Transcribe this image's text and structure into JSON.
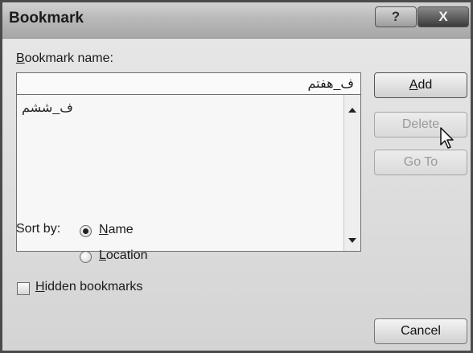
{
  "window": {
    "title": "Bookmark",
    "help_glyph": "?",
    "close_glyph": "X"
  },
  "bookmark_name": {
    "label_mnemonic": "B",
    "label_rest": "ookmark name:",
    "value": "ف_هفتم"
  },
  "list": {
    "items": [
      "ف_ششم"
    ]
  },
  "buttons": {
    "add_mnemonic": "A",
    "add_rest": "dd",
    "delete": "Delete",
    "goto": "Go To",
    "cancel": "Cancel"
  },
  "sort": {
    "label": "Sort by:",
    "name_mnemonic": "N",
    "name_rest": "ame",
    "location_mnemonic": "L",
    "location_rest": "ocation",
    "selected": "Name"
  },
  "hidden": {
    "mnemonic": "H",
    "rest": "idden bookmarks",
    "checked": false
  }
}
